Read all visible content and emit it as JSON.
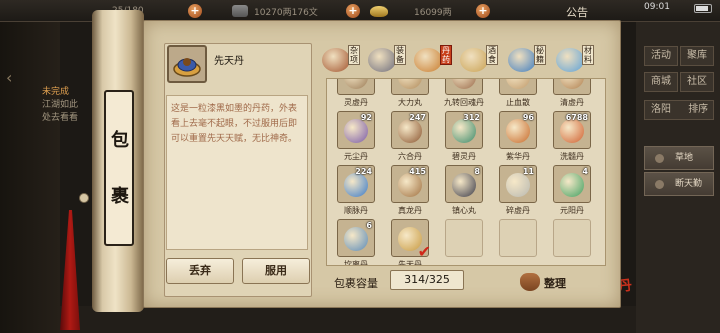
{
  "topbar": {
    "stat_fraction": "25/180",
    "money": "10270两176文",
    "ingot": "16099两",
    "notice": "公告",
    "time": "09:01"
  },
  "quest": {
    "title": "未完成",
    "line1": "江湖如此",
    "line2": "处去看看"
  },
  "right_panel": {
    "buttons": [
      "活动",
      "聚库",
      "商城",
      "社区"
    ],
    "location": "洛阳",
    "sort_label": "排序",
    "side_items": [
      "草地",
      "断天勤"
    ]
  },
  "scroll": {
    "title_chars": [
      "包",
      "裹"
    ]
  },
  "detail": {
    "name": "先天丹",
    "description": "这是一粒漆黑如墨的丹药，外表看上去毫不起眼，不过服用后即可以重置先天天赋，无比神奇。",
    "discard_label": "丢弃",
    "use_label": "服用"
  },
  "categories": [
    {
      "label": "杂项",
      "icon": "misc-pot-icon",
      "color": "#a0502a",
      "active": false
    },
    {
      "label": "装备",
      "icon": "equipment-icon",
      "color": "#6a6a7a",
      "active": false
    },
    {
      "label": "丹药",
      "icon": "pill-icon",
      "color": "#c87a2a",
      "active": true
    },
    {
      "label": "酒食",
      "icon": "food-icon",
      "color": "#c8a050",
      "active": false
    },
    {
      "label": "秘籍",
      "icon": "book-icon",
      "color": "#3a7abf",
      "active": false
    },
    {
      "label": "材料",
      "icon": "material-crystal-icon",
      "color": "#5aa0d8",
      "active": false
    }
  ],
  "items": [
    {
      "name": "灵虚丹",
      "qty": "",
      "color": "#9a7a55",
      "empty": false
    },
    {
      "name": "大力丸",
      "qty": "",
      "color": "#b08a5a",
      "empty": false
    },
    {
      "name": "九转回魂丹",
      "qty": "",
      "color": "#9a6a4a",
      "empty": false
    },
    {
      "name": "止血散",
      "qty": "",
      "color": "#c09a6a",
      "empty": false
    },
    {
      "name": "清虚丹",
      "qty": "",
      "color": "#b08050",
      "empty": false
    },
    {
      "name": "元尘丹",
      "qty": "92",
      "color": "#7a5aa8",
      "empty": false
    },
    {
      "name": "六合丹",
      "qty": "247",
      "color": "#8a5530",
      "empty": false
    },
    {
      "name": "碧灵丹",
      "qty": "312",
      "color": "#3a8a6a",
      "empty": false
    },
    {
      "name": "紫华丹",
      "qty": "96",
      "color": "#c86a2a",
      "empty": false
    },
    {
      "name": "洗髓丹",
      "qty": "6788",
      "color": "#d06030",
      "empty": false
    },
    {
      "name": "顺脉丹",
      "qty": "224",
      "color": "#3a7ac8",
      "empty": false
    },
    {
      "name": "真龙丹",
      "qty": "415",
      "color": "#a07040",
      "empty": false
    },
    {
      "name": "镇心丸",
      "qty": "8",
      "color": "#3a3a48",
      "empty": false
    },
    {
      "name": "碎虚丹",
      "qty": "11",
      "color": "#b8b8b0",
      "empty": false
    },
    {
      "name": "元阳丹",
      "qty": "4",
      "color": "#40a060",
      "empty": false
    },
    {
      "name": "坎离丹",
      "qty": "6",
      "color": "#5a8ab8",
      "empty": false
    },
    {
      "name": "先天丹",
      "qty": "",
      "color": "#c89a40",
      "empty": false,
      "selected": true
    },
    {
      "name": "",
      "qty": "",
      "color": "",
      "empty": true
    },
    {
      "name": "",
      "qty": "",
      "color": "",
      "empty": true
    },
    {
      "name": "",
      "qty": "",
      "color": "",
      "empty": true
    }
  ],
  "capacity": {
    "label": "包裹容量",
    "value": "314/325"
  },
  "sort": {
    "label": "整理",
    "icon": "money-bag-icon"
  },
  "seal": "高丹",
  "colors": {
    "accent_red": "#c8401c",
    "panel": "#d6c8a6",
    "parchment": "#eee4cc"
  }
}
